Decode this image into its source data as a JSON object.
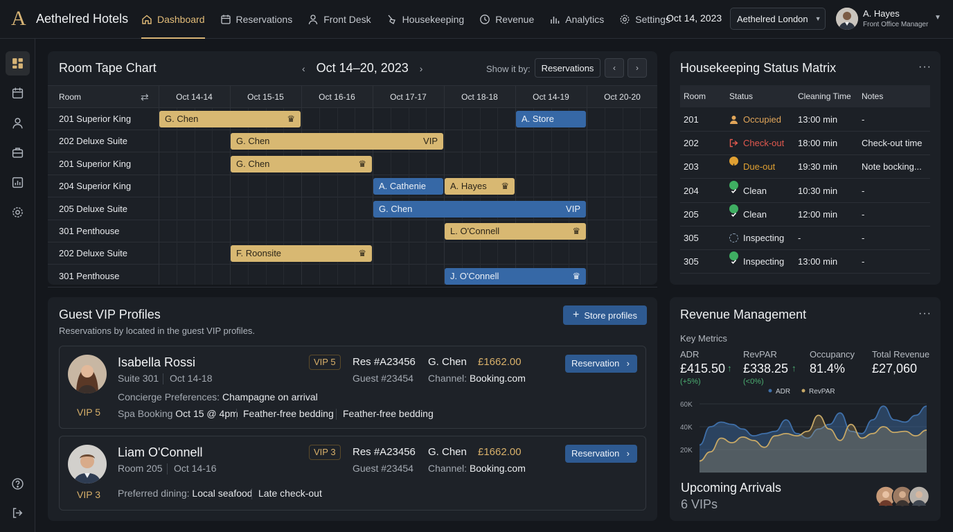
{
  "brand": {
    "logo_letter": "A",
    "name": "Aethelred Hotels"
  },
  "nav": [
    {
      "label": "Dashboard",
      "icon": "home-icon",
      "active": true
    },
    {
      "label": "Reservations",
      "icon": "calendar-icon"
    },
    {
      "label": "Front Desk",
      "icon": "person-icon"
    },
    {
      "label": "Housekeeping",
      "icon": "broom-icon"
    },
    {
      "label": "Revenue",
      "icon": "clock-dollar-icon"
    },
    {
      "label": "Analytics",
      "icon": "bar-chart-icon"
    },
    {
      "label": "Settings",
      "icon": "gear-icon"
    }
  ],
  "header": {
    "date": "Oct 14, 2023",
    "hotel": "Aethelred London",
    "user_name": "A. Hayes",
    "user_role": "Front Office Manager"
  },
  "sidebar": [
    {
      "icon": "dashboard-grid-icon",
      "active": true
    },
    {
      "icon": "calendar-icon"
    },
    {
      "icon": "person-icon"
    },
    {
      "icon": "suitcase-icon"
    },
    {
      "icon": "chart-icon"
    },
    {
      "icon": "gear-icon"
    },
    {
      "icon": "help-icon"
    },
    {
      "icon": "logout-icon"
    }
  ],
  "tape": {
    "title": "Room Tape Chart",
    "week": "Oct 14–20, 2023",
    "show_by_label": "Show it by:",
    "show_by_value": "Reservations",
    "room_header": "Room",
    "days": [
      "Oct 14-14",
      "Oct 15-15",
      "Oct 16-16",
      "Oct 17-17",
      "Oct 18-18",
      "Oct 14-19",
      "Oct 20-20"
    ],
    "rows": [
      {
        "room": "201 Superior King",
        "bookings": [
          {
            "guest": "G. Chen",
            "start": 0,
            "span": 2,
            "color": "gold",
            "tag": "♛"
          },
          {
            "guest": "A. Store",
            "start": 5,
            "span": 1,
            "color": "blue",
            "tag": ""
          }
        ]
      },
      {
        "room": "202 Deluxe Suite",
        "bookings": [
          {
            "guest": "G. Chen",
            "start": 1,
            "span": 3,
            "color": "gold",
            "tag": "VIP"
          }
        ]
      },
      {
        "room": "201 Superior King",
        "bookings": [
          {
            "guest": "G. Chen",
            "start": 1,
            "span": 2,
            "color": "gold",
            "tag": "♛"
          }
        ]
      },
      {
        "room": "204 Superior King",
        "bookings": [
          {
            "guest": "A. Cathenie",
            "start": 3,
            "span": 1,
            "color": "blue",
            "tag": ""
          },
          {
            "guest": "A. Hayes",
            "start": 4,
            "span": 1,
            "color": "gold",
            "tag": "♛"
          }
        ]
      },
      {
        "room": "205 Deluxe Suite",
        "bookings": [
          {
            "guest": "G. Chen",
            "start": 3,
            "span": 3,
            "color": "blue",
            "tag": "VIP"
          }
        ]
      },
      {
        "room": "301 Penthouse",
        "bookings": [
          {
            "guest": "L. O'Connell",
            "start": 4,
            "span": 2,
            "color": "gold",
            "tag": "♛"
          }
        ]
      },
      {
        "room": "202 Deluxe Suite",
        "bookings": [
          {
            "guest": "F. Roonsite",
            "start": 1,
            "span": 2,
            "color": "gold",
            "tag": "♛"
          }
        ]
      },
      {
        "room": "301 Penthouse",
        "bookings": [
          {
            "guest": "J. O'Connell",
            "start": 4,
            "span": 2,
            "color": "blue",
            "tag": "♛"
          }
        ]
      }
    ]
  },
  "housekeeping": {
    "title": "Housekeeping Status Matrix",
    "columns": [
      "Room",
      "Status",
      "Cleaning Time",
      "Notes"
    ],
    "rows": [
      {
        "room": "201",
        "status": "Occupied",
        "kind": "occupied",
        "time": "13:00 min",
        "notes": "-"
      },
      {
        "room": "202",
        "status": "Check-out",
        "kind": "checkout",
        "time": "18:00 min",
        "notes": "Check-out time"
      },
      {
        "room": "203",
        "status": "Due-out",
        "kind": "dueout",
        "time": "19:30 min",
        "notes": "Note bocking..."
      },
      {
        "room": "204",
        "status": "Clean",
        "kind": "clean",
        "time": "10:30 min",
        "notes": "-"
      },
      {
        "room": "205",
        "status": "Clean",
        "kind": "clean",
        "time": "12:00 min",
        "notes": "-"
      },
      {
        "room": "305",
        "status": "Inspecting",
        "kind": "inspecting-pending",
        "time": "-",
        "notes": "-"
      },
      {
        "room": "305",
        "status": "Inspecting",
        "kind": "clean",
        "time": "13:00 min",
        "notes": "-"
      }
    ],
    "status_colors": {
      "occupied": "#e0a559",
      "checkout": "#e0584e",
      "dueout": "#e0a032",
      "clean": "#3fae62"
    }
  },
  "vip": {
    "title": "Guest VIP Profiles",
    "subtitle": "Reservations by located in the guest VIP profiles.",
    "store_label": "Store profiles",
    "profiles": [
      {
        "name": "Isabella Rossi",
        "room": "Suite 301",
        "dates": "Oct 14-18",
        "level": "VIP 5",
        "res": "Res #A23456",
        "guest_no": "Guest #23454",
        "assigned": "G. Chen",
        "channel_label": "Channel:",
        "channel": "Booking.com",
        "amount": "£1662.00",
        "btn": "Reservation",
        "pref_label": "Concierge Preferences:",
        "pref_value": "Champagne on arrival",
        "spa_label": "Spa Booking",
        "spa_value": "Oct 15 @ 4pm",
        "extra1": "Feather-free bedding",
        "extra2": "Feather-free bedding"
      },
      {
        "name": "Liam O'Connell",
        "room": "Room 205",
        "dates": "Oct 14-16",
        "level": "VIP 3",
        "res": "Res #A23456",
        "guest_no": "Guest #23454",
        "assigned": "G. Chen",
        "channel_label": "Channel:",
        "channel": "Booking.com",
        "amount": "£1662.00",
        "btn": "Reservation",
        "pref_label": "Preferred dining:",
        "pref_value": "Local seafood",
        "extra1": "Late check-out"
      }
    ]
  },
  "revenue": {
    "title": "Revenue Management",
    "key_metrics_label": "Key Metrics",
    "metrics": [
      {
        "label": "ADR",
        "value": "£415.50",
        "change": "(+5%)",
        "arrow": "↑"
      },
      {
        "label": "RevPAR",
        "value": "£338.25",
        "change": "(<0%)",
        "arrow": "↑"
      },
      {
        "label": "Occupancy",
        "value": "81.4%"
      },
      {
        "label": "Total Revenue",
        "value": "£27,060"
      }
    ],
    "arrivals_title": "Upcoming Arrivals",
    "arrivals_count": "6 VIPs"
  },
  "chart_data": {
    "type": "area",
    "series": [
      {
        "name": "ADR",
        "color": "#3f6fa8",
        "values": [
          24,
          40,
          44,
          42,
          38,
          32,
          34,
          36,
          46,
          34,
          30,
          38,
          42,
          52,
          36,
          34,
          46,
          58,
          46,
          44,
          50,
          58
        ]
      },
      {
        "name": "RevPAR",
        "color": "#c7a866",
        "values": [
          10,
          18,
          30,
          26,
          31,
          28,
          22,
          32,
          34,
          32,
          36,
          50,
          38,
          28,
          42,
          30,
          34,
          40,
          35,
          36,
          32,
          37
        ]
      }
    ],
    "y_ticks": [
      "60K",
      "40K",
      "20K"
    ],
    "ylim": [
      0,
      60
    ],
    "legend_position": "top-center",
    "grid": true
  }
}
